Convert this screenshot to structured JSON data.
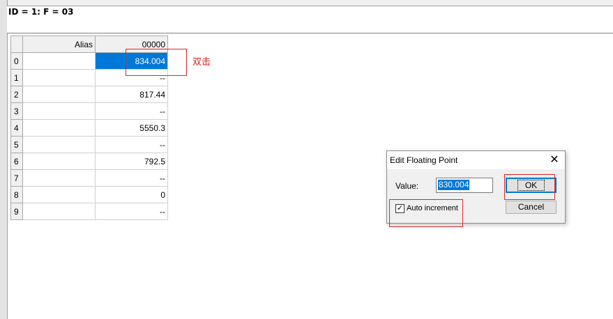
{
  "info_bar": {
    "text": "ID = 1: F = 03"
  },
  "grid": {
    "headers": [
      "Alias",
      "00000"
    ],
    "rows": [
      {
        "index": "0",
        "alias": "",
        "value": "834.004",
        "selected": true
      },
      {
        "index": "1",
        "alias": "",
        "value": "--"
      },
      {
        "index": "2",
        "alias": "",
        "value": "817.44"
      },
      {
        "index": "3",
        "alias": "",
        "value": "--"
      },
      {
        "index": "4",
        "alias": "",
        "value": "5550.3"
      },
      {
        "index": "5",
        "alias": "",
        "value": "--"
      },
      {
        "index": "6",
        "alias": "",
        "value": "792.5"
      },
      {
        "index": "7",
        "alias": "",
        "value": "--"
      },
      {
        "index": "8",
        "alias": "",
        "value": "0"
      },
      {
        "index": "9",
        "alias": "",
        "value": "--"
      }
    ]
  },
  "annotation": {
    "text": "双击",
    "color": "#e02424"
  },
  "dialog": {
    "title": "Edit Floating Point",
    "close_icon": "close-icon",
    "value_label": "Value:",
    "value": "830.004",
    "ok_label": "OK",
    "cancel_label": "Cancel",
    "auto_increment_label": "Auto increment",
    "auto_increment_checked": true
  },
  "colors": {
    "selection": "#0078d7",
    "annotation": "#e02424"
  }
}
